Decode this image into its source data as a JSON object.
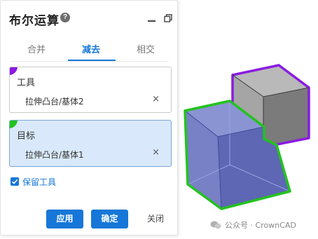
{
  "dialog": {
    "title": "布尔运算",
    "help_icon": "?",
    "tabs": [
      {
        "label": "合并",
        "active": false
      },
      {
        "label": "减去",
        "active": true
      },
      {
        "label": "相交",
        "active": false
      }
    ],
    "tool": {
      "label": "工具",
      "item": "拉伸凸台/基体2",
      "remove": "×",
      "corner_color": "#8a1be0"
    },
    "target": {
      "label": "目标",
      "item": "拉伸凸台/基体1",
      "remove": "×",
      "corner_color": "#22c31c"
    },
    "keep_tool": {
      "label": "保留工具",
      "checked": true
    },
    "buttons": {
      "apply": "应用",
      "ok": "确定",
      "close": "关闭"
    }
  },
  "watermark": {
    "text": "公众号 · CrownCAD"
  },
  "colors": {
    "accent": "#1677d8",
    "tool_cube_edge": "#8a1be0",
    "target_cube_edge": "#22c31c",
    "target_cube_fill": "#6c77c2",
    "tool_cube_fill": "#8a8a8a"
  }
}
